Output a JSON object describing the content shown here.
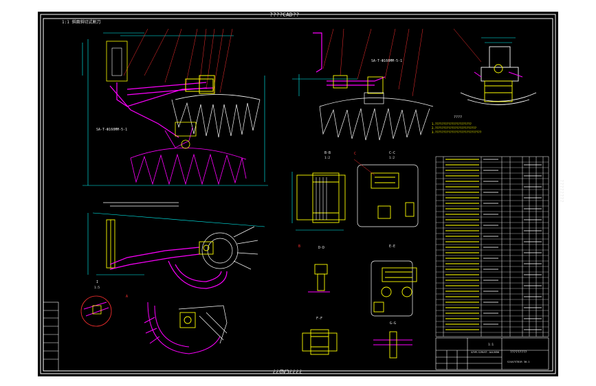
{
  "viewport": {
    "top_banner": "????CAD??",
    "bottom_banner": "????CAD??",
    "side_text": "????????"
  },
  "drawing": {
    "sheet_title": "1:1 斜面斜切式割刀",
    "tech_notes_title": "????",
    "title_block_name": "?????????",
    "title_block_drawing_no": "SJ4A7ST81R 30-1",
    "title_block_code": "XZYM-SJ9UST-1A4JKR0",
    "title_block_scale": "1:1"
  },
  "views": {
    "section_bb": "B-B",
    "section_cc": "C-C",
    "section_dd": "D-D",
    "section_ee": "E-E",
    "section_ff": "F-F",
    "section_gg": "G-G",
    "detail_i": "I",
    "scale_12": "1:2",
    "scale_15": "1:5"
  },
  "colors": {
    "background": "#000000",
    "frame": "#ffffff",
    "part": "#ff00ff",
    "hatch": "#ffff00",
    "dim": "#00ffff",
    "leader": "#ff3030",
    "text": "#ffffff"
  }
}
